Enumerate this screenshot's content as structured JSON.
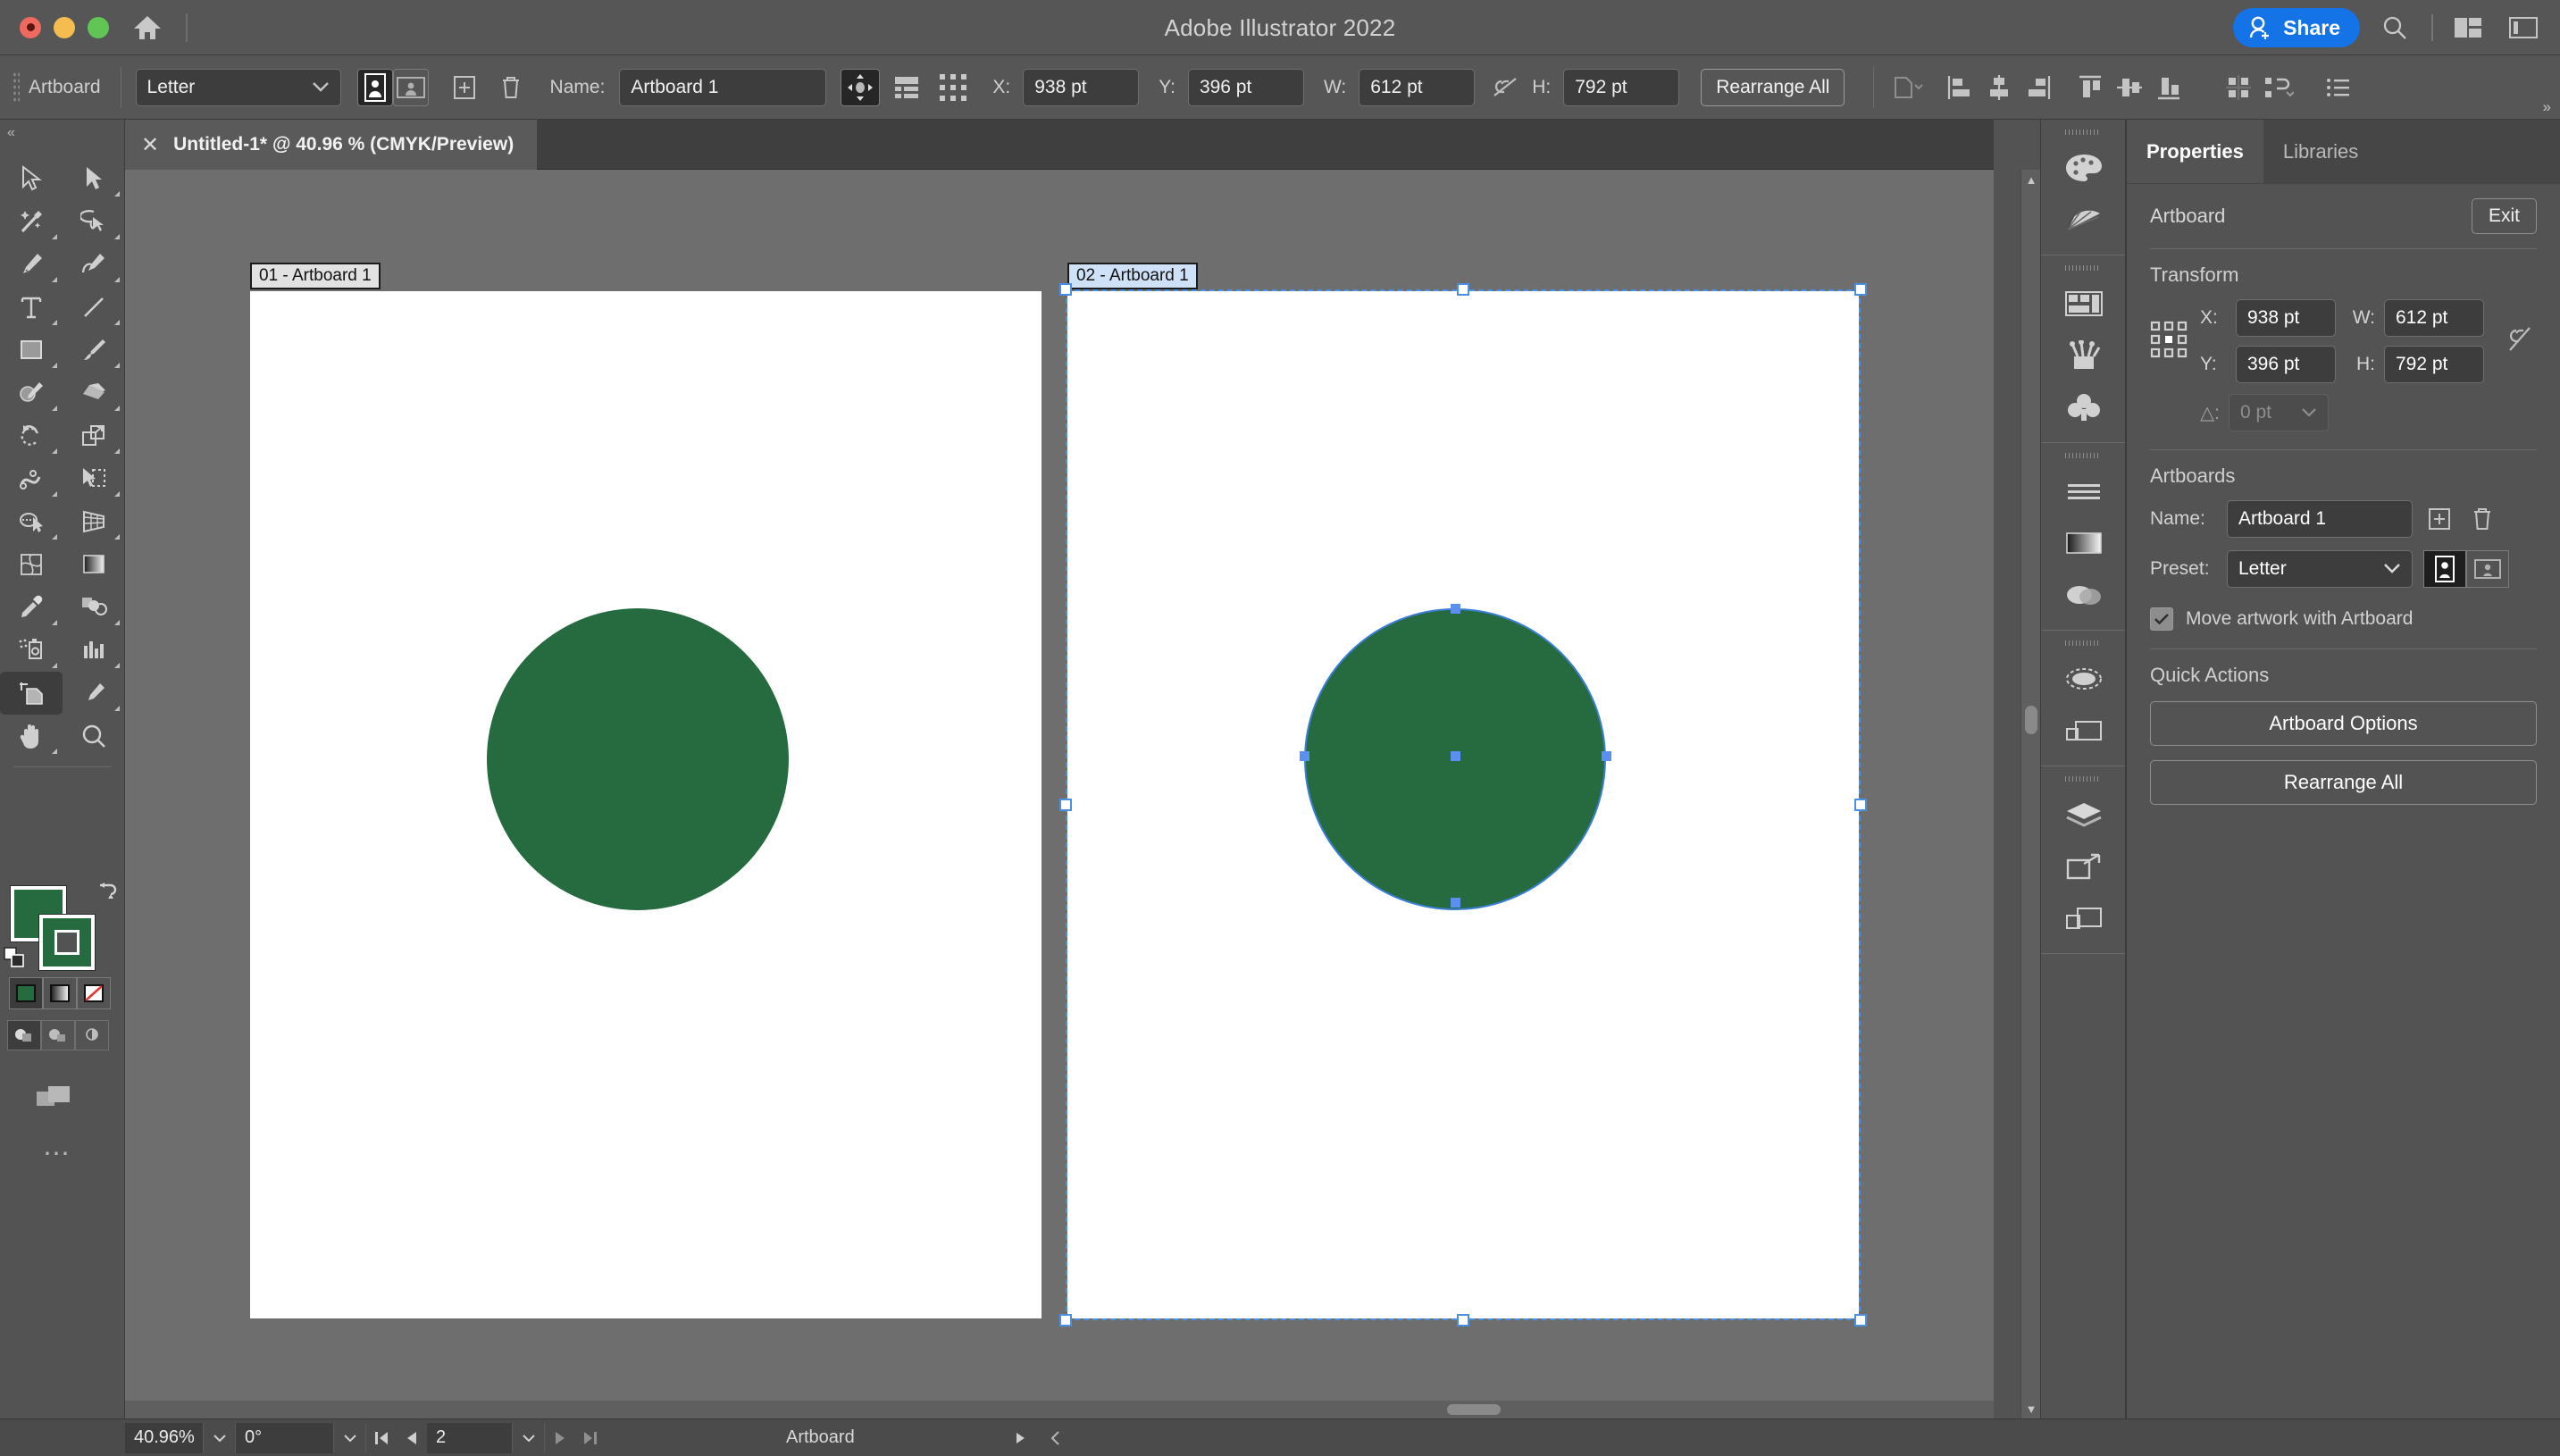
{
  "window": {
    "title": "Adobe Illustrator 2022",
    "traffic_lights": [
      "close",
      "minimize",
      "zoom"
    ],
    "home_icon": "home-icon",
    "share_label": "Share",
    "search_icon": "search-icon",
    "arrange_icon": "arrange-documents-icon",
    "workspace_icon": "workspace-switcher-icon"
  },
  "control_bar": {
    "context_label": "Artboard",
    "preset_value": "Letter",
    "orientation": {
      "portrait": "portrait-icon",
      "landscape": "landscape-icon",
      "selected": "portrait"
    },
    "new_artboard_icon": "new-artboard-icon",
    "delete_artboard_icon": "delete-artboard-icon",
    "name_label": "Name:",
    "name_value": "Artboard 1",
    "move_artboard_icon": "move-artboard-with-artwork-icon",
    "artboard_options_icon": "artboard-options-icon",
    "reference_point_icon": "reference-point-icon",
    "x_label": "X:",
    "x_value": "938 pt",
    "y_label": "Y:",
    "y_value": "396 pt",
    "w_label": "W:",
    "w_value": "612 pt",
    "link_icon": "unlinked-proportions-icon",
    "h_label": "H:",
    "h_value": "792 pt",
    "rearrange_label": "Rearrange All",
    "align_icons": [
      "align-left-icon",
      "align-horizontal-center-icon",
      "align-right-icon",
      "align-top-icon",
      "align-vertical-center-icon",
      "align-bottom-icon",
      "distribute-icon",
      "distribute-spacing-icon",
      "more-options-icon"
    ]
  },
  "tab": {
    "close_icon": "close-icon",
    "label": "Untitled-1* @ 40.96 % (CMYK/Preview)"
  },
  "toolbar": {
    "collapse_icon": "collapse-panel-icon",
    "tools": [
      "selection-tool",
      "direct-selection-tool",
      "magic-wand-tool",
      "lasso-tool",
      "pen-tool",
      "curvature-tool",
      "type-tool",
      "line-segment-tool",
      "rectangle-tool",
      "paintbrush-tool",
      "shaper-tool",
      "eraser-tool",
      "rotate-tool",
      "scale-tool",
      "width-tool",
      "free-transform-tool",
      "shape-builder-tool",
      "perspective-grid-tool",
      "mesh-tool",
      "gradient-tool",
      "eyedropper-tool",
      "blend-tool",
      "symbol-sprayer-tool",
      "column-graph-tool",
      "artboard-tool",
      "slice-tool",
      "hand-tool",
      "zoom-tool"
    ],
    "selected_tool": "artboard-tool",
    "fill_color": "#256B3F",
    "stroke_color": "#256B3F",
    "swap_icon": "swap-fill-stroke-icon",
    "default_icon": "default-fill-stroke-icon",
    "paint_modes": [
      "color-swatch-mode",
      "gradient-mode",
      "none-mode"
    ],
    "paint_mode_selected": "color-swatch-mode",
    "draw_modes": [
      "draw-normal",
      "draw-behind",
      "draw-inside"
    ],
    "draw_mode_selected": "draw-normal",
    "screen_mode_icon": "change-screen-mode-icon",
    "more_tools_icon": "edit-toolbar-icon"
  },
  "canvas": {
    "background": "#6e6e6e",
    "artboards": [
      {
        "label": "01 - Artboard 1",
        "selected": false,
        "shape_color": "#256B3F"
      },
      {
        "label": "02 - Artboard 1",
        "selected": true,
        "shape_color": "#256B3F"
      }
    ],
    "selection_color": "#4a90e2"
  },
  "dock": {
    "groups": [
      {
        "icons": [
          "color-panel-icon",
          "color-guide-icon"
        ]
      },
      {
        "icons": [
          "swatches-panel-icon",
          "brushes-panel-icon",
          "symbols-panel-icon"
        ]
      },
      {
        "icons": [
          "stroke-panel-icon",
          "gradient-panel-icon",
          "transparency-panel-icon"
        ]
      },
      {
        "icons": [
          "appearance-panel-icon",
          "graphic-styles-panel-icon"
        ]
      },
      {
        "icons": [
          "layers-panel-icon",
          "export-panel-icon",
          "artboards-panel-icon"
        ]
      }
    ]
  },
  "properties": {
    "collapse_icon": "collapse-panels-icon",
    "tabs": [
      {
        "label": "Properties",
        "active": true
      },
      {
        "label": "Libraries",
        "active": false
      }
    ],
    "context": {
      "title": "Artboard",
      "exit_label": "Exit"
    },
    "transform": {
      "heading": "Transform",
      "reference_point_icon": "reference-point-grid-icon",
      "x_label": "X:",
      "x_value": "938 pt",
      "y_label": "Y:",
      "y_value": "396 pt",
      "w_label": "W:",
      "w_value": "612 pt",
      "h_label": "H:",
      "h_value": "792 pt",
      "link_icon": "unlinked-proportions-icon",
      "angle_label": "△:",
      "angle_value": "0 pt",
      "angle_disabled": true
    },
    "artboards": {
      "heading": "Artboards",
      "name_label": "Name:",
      "name_value": "Artboard 1",
      "add_icon": "new-artboard-icon",
      "delete_icon": "delete-artboard-icon",
      "preset_label": "Preset:",
      "preset_value": "Letter",
      "orientation_portrait_icon": "portrait-icon",
      "orientation_landscape_icon": "landscape-icon",
      "orientation_selected": "portrait",
      "move_artwork_label": "Move artwork with Artboard",
      "move_artwork_checked": true
    },
    "quick_actions": {
      "heading": "Quick Actions",
      "buttons": [
        "Artboard Options",
        "Rearrange All"
      ]
    }
  },
  "status_bar": {
    "zoom_value": "40.96%",
    "rotation_value": "0°",
    "first_icon": "first-artboard-icon",
    "prev_icon": "previous-artboard-icon",
    "artboard_number": "2",
    "next_icon": "next-artboard-icon",
    "last_icon": "last-artboard-icon",
    "status_text": "Artboard",
    "status_menu_icon": "status-menu-icon",
    "resize_icon": "resize-handle-icon"
  }
}
